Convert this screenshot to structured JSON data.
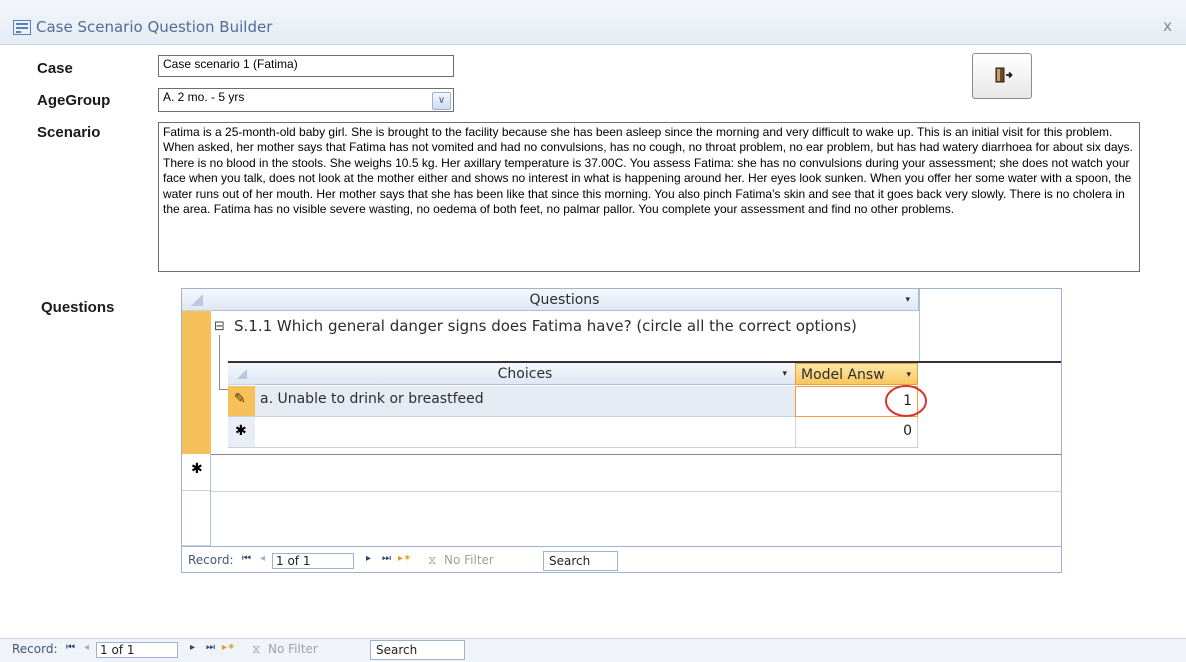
{
  "window": {
    "title": "Case Scenario Question Builder",
    "close_glyph": "x"
  },
  "form": {
    "case_label": "Case",
    "case_value": "Case scenario 1 (Fatima)",
    "agegroup_label": "AgeGroup",
    "agegroup_value": "A. 2 mo. - 5 yrs",
    "scenario_label": "Scenario",
    "scenario_text": "Fatima is a 25-month-old baby girl. She is brought to the facility because she has been asleep since the morning and very difficult to wake up. This is an initial visit for this problem. When asked, her mother says that Fatima has not vomited and had no convulsions, has no cough, no throat problem, no ear problem, but has had watery diarrhoea for about six days. There is no blood in the stools. She weighs 10.5 kg. Her axillary temperature is 37.00C. You assess Fatima: she has no convulsions during your assessment; she does not watch your face when you talk, does not look at the mother either and shows no interest in what is happening around her. Her eyes look sunken. When you offer her some water with a spoon, the water runs out of her mouth. Her mother says that she has been like that since this morning. You also pinch Fatima’s skin and see that it goes back very slowly. There is no cholera in the area. Fatima has no visible severe wasting, no oedema of both feet, no palmar pallor. You complete your assessment and find no other problems.",
    "questions_label": "Questions"
  },
  "subform": {
    "questions_header": "Questions",
    "question_row": "S.1.1 Which general danger signs does Fatima have? (circle all the correct options)",
    "choices_header": "Choices",
    "model_answer_header": "Model Answ",
    "choices": [
      {
        "text": "a. Unable to drink or breastfeed",
        "answer": "1"
      },
      {
        "text": "",
        "answer": "0"
      }
    ],
    "expand_glyph": "⊟",
    "new_row_glyph": "✱",
    "edit_glyph": "✎"
  },
  "subform_nav": {
    "label": "Record:",
    "position": "1 of 1",
    "filter": "No Filter",
    "search": "Search"
  },
  "main_nav": {
    "label": "Record:",
    "position": "1 of 1",
    "filter": "No Filter",
    "search": "Search"
  },
  "colors": {
    "accent": "#4f6d98",
    "highlight_circle": "#d9312b",
    "selected_row": "#f6c05a"
  }
}
